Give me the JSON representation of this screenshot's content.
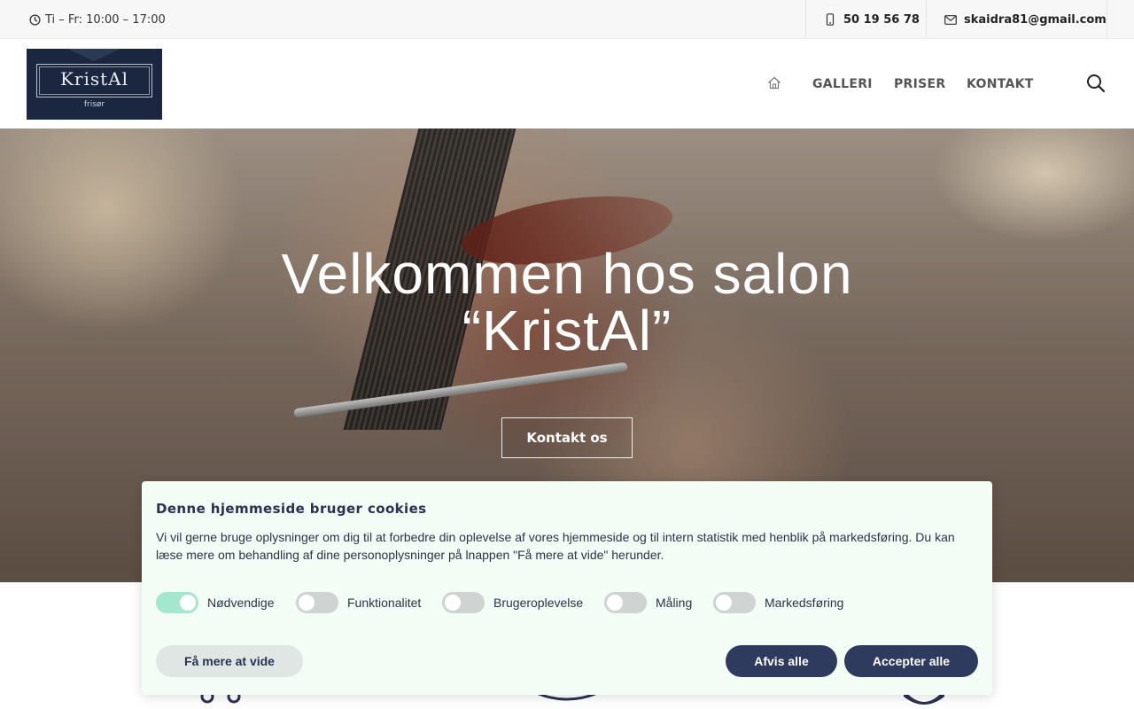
{
  "topbar": {
    "hours": "Ti – Fr: 10:00 – 17:00",
    "phone": "50 19 56 78",
    "email": "skaidra81@gmail.com",
    "icons": {
      "hours": "clock-icon",
      "phone": "phone-icon",
      "email": "envelope-icon"
    }
  },
  "header": {
    "logo": {
      "name": "KristAl",
      "subtitle": "frisør"
    },
    "nav": [
      {
        "label": "",
        "icon": "home-icon"
      },
      {
        "label": "GALLERI"
      },
      {
        "label": "PRISER"
      },
      {
        "label": "KONTAKT"
      }
    ],
    "search_icon": "search-icon"
  },
  "hero": {
    "title_line1": "Velkommen hos salon",
    "title_line2": "“KristAl”",
    "button_label": "Kontakt os"
  },
  "cookie": {
    "title": "Denne hjemmeside bruger cookies",
    "text": "Vi vil gerne bruge oplysninger om dig til at forbedre din oplevelse af vores hjemmeside og til intern statistik med henblik på markedsføring. Du kan læse mere om behandling af dine personoplysninger på lnappen \"Få mere at vide\" herunder.",
    "toggles": [
      {
        "label": "Nødvendige",
        "on": true
      },
      {
        "label": "Funktionalitet",
        "on": false
      },
      {
        "label": "Brugeroplevelse",
        "on": false
      },
      {
        "label": "Måling",
        "on": false
      },
      {
        "label": "Markedsføring",
        "on": false
      }
    ],
    "buttons": {
      "more": "Få mere at vide",
      "reject": "Afvis alle",
      "accept": "Accepter alle"
    }
  },
  "colors": {
    "accent_dark": "#2e3a5e",
    "toggle_on": "#a5e6cf",
    "dialog_bg": "#f4fcf6",
    "logo_bg": "#1b2740"
  }
}
